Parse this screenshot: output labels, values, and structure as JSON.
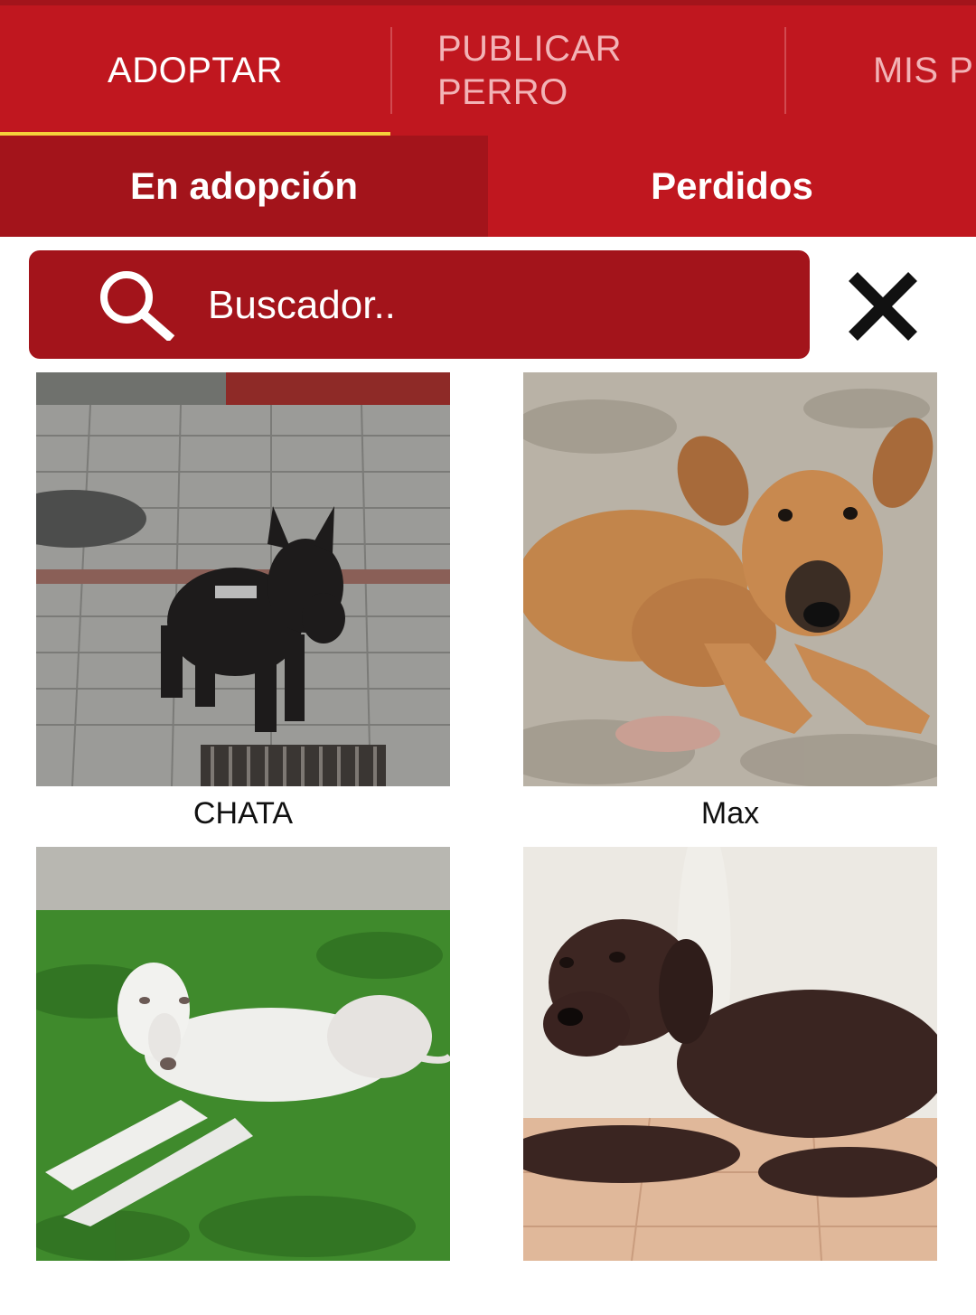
{
  "tabs": [
    {
      "label": "ADOPTAR",
      "active": true
    },
    {
      "label": "PUBLICAR\nPERRO",
      "line1": "PUBLICAR",
      "line2": "PERRO",
      "active": false
    },
    {
      "label": "MIS PERROS",
      "active": false
    }
  ],
  "subtabs": [
    {
      "label": "En adopción",
      "active": true
    },
    {
      "label": "Perdidos",
      "active": false
    }
  ],
  "search": {
    "placeholder": "Buscador..",
    "value": ""
  },
  "dogs": [
    {
      "name": "CHATA",
      "photo": "black schnauzer on paving stones"
    },
    {
      "name": "Max",
      "photo": "tan puppy lying on ground"
    },
    {
      "name": "",
      "photo": "white dog lying on grass"
    },
    {
      "name": "",
      "photo": "chocolate labrador lying on tiles"
    }
  ],
  "colors": {
    "primary": "#c0171f",
    "primary_dark": "#a3141b",
    "indicator": "#f5d13b"
  },
  "icons": {
    "search": "search-icon",
    "close": "close-icon"
  }
}
